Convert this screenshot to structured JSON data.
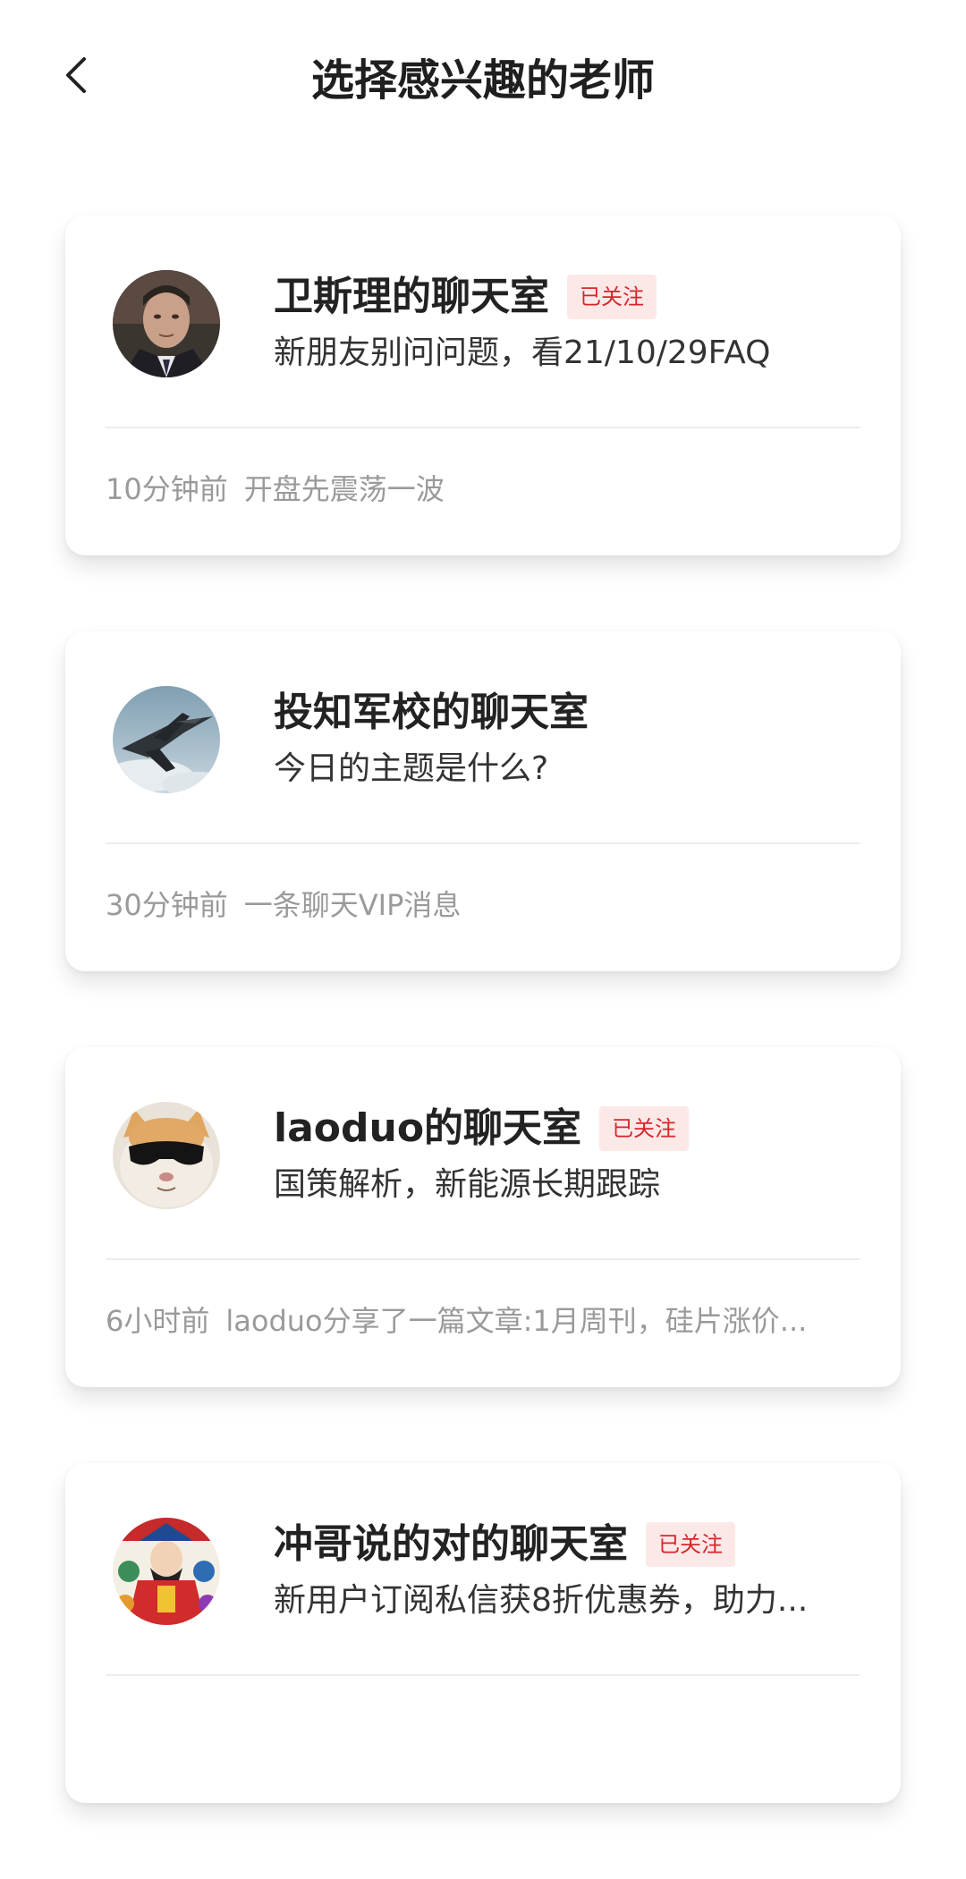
{
  "header": {
    "title": "选择感兴趣的老师",
    "back_icon": "chevron-left-icon"
  },
  "colors": {
    "badge_text": "#d8262b",
    "badge_bg": "#fde8e8",
    "meta_text": "#9a9a9a"
  },
  "cards": [
    {
      "title": "卫斯理的聊天室",
      "badge": "已关注",
      "desc": "新朋友别问问题，看21/10/29FAQ",
      "time": "10分钟前",
      "message": "开盘先震荡一波",
      "avatar": "man-in-suit-avatar"
    },
    {
      "title": "投知军校的聊天室",
      "badge": "",
      "desc": "今日的主题是什么?",
      "time": "30分钟前",
      "message": "一条聊天VIP消息",
      "avatar": "fighter-jet-avatar"
    },
    {
      "title": "laoduo的聊天室",
      "badge": "已关注",
      "desc": "国策解析，新能源长期跟踪",
      "time": "6小时前",
      "message": "laoduo分享了一篇文章:1月周刊，硅片涨价...",
      "avatar": "cat-sunglasses-avatar"
    },
    {
      "title": "冲哥说的对的聊天室",
      "badge": "已关注",
      "desc": "新用户订阅私信获8折优惠券，助力...",
      "time": "",
      "message": "",
      "avatar": "fortune-god-avatar"
    }
  ]
}
